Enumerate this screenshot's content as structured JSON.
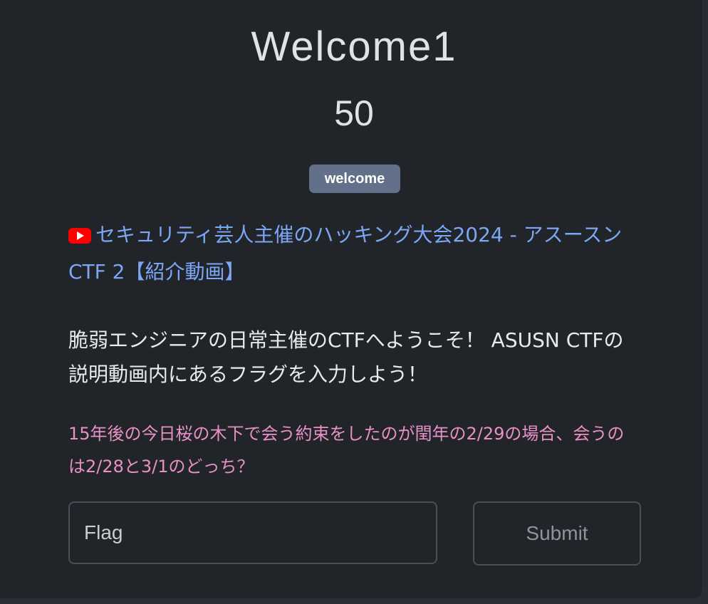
{
  "challenge": {
    "name": "Welcome1",
    "value": "50",
    "tag": "welcome"
  },
  "description": {
    "video_icon": "youtube-icon",
    "video_link_text": "セキュリティ芸人主催のハッキング大会2024 - アスースンCTF 2【紹介動画】",
    "intro": "脆弱エンジニアの日常主催のCTFへようこそ！ ASUSN CTFの説明動画内にあるフラグを入力しよう！",
    "hint": "15年後の今日桜の木下で会う約束をしたのが閏年の2/29の場合、会うのは2/28と3/1のどっち？"
  },
  "form": {
    "flag_placeholder": "Flag",
    "submit_label": "Submit"
  },
  "colors": {
    "background": "#212429",
    "link": "#7ba7f5",
    "hint": "#e891c6",
    "tag": "#627089",
    "youtube_red": "#ff0000"
  }
}
